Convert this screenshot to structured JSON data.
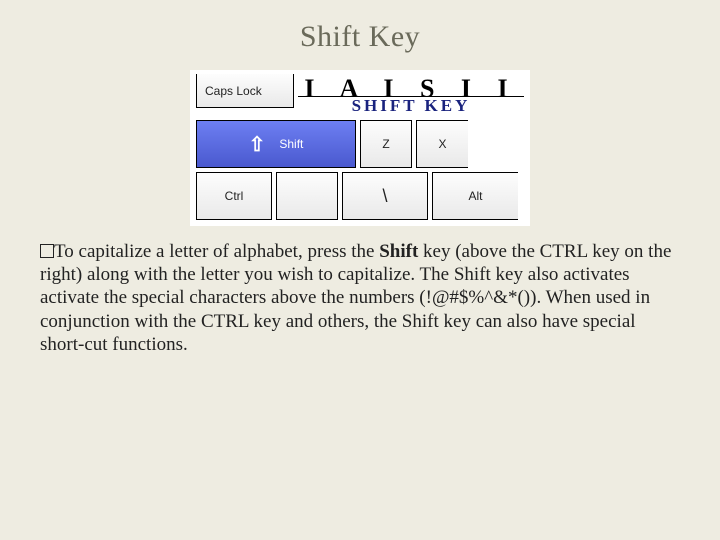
{
  "title": "Shift Key",
  "keyboard": {
    "row0": {
      "caps": "Caps Lock",
      "letters": "I A I S I I",
      "shiftKeyLabel": "SHIFT KEY"
    },
    "row1": {
      "shiftArrow": "⇧",
      "shiftLabel": "Shift",
      "z": "Z",
      "x": "X"
    },
    "row2": {
      "ctrl": "Ctrl",
      "backslash": "\\",
      "alt": "Alt"
    }
  },
  "body": {
    "pre": "To capitalize a letter of alphabet, press the ",
    "bold": "Shift",
    "post": " key (above the CTRL key on the right) along with the letter you wish to capitalize. The Shift key also activates activate the special characters above the numbers (!@#$%^&*()). When used in conjunction with the CTRL key and others, the Shift key can also have special short-cut functions."
  }
}
